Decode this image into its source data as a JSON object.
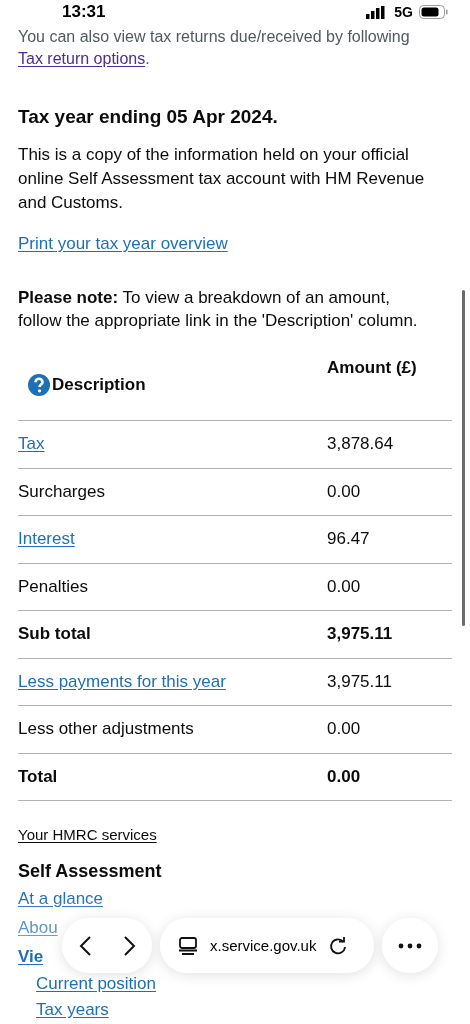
{
  "status_bar": {
    "time": "13:31",
    "network": "5G"
  },
  "intro": {
    "text": "You can also view tax returns due/received by following",
    "link": "Tax return options",
    "end": "."
  },
  "heading": "Tax year ending 05 Apr 2024.",
  "description": "This is a copy of the information held on your official online Self Assessment tax account with HM Revenue and Customs.",
  "print_link": "Print your tax year overview",
  "note": {
    "label": "Please note:",
    "text": "To view a breakdown of an amount, follow the appropriate link in the 'Description' column."
  },
  "table": {
    "columns": [
      "Description",
      "Amount (£)"
    ],
    "rows": [
      {
        "kind": "link",
        "description": "Tax",
        "amount": "3,878.64"
      },
      {
        "kind": "plain",
        "description": "Surcharges",
        "amount": "0.00"
      },
      {
        "kind": "link",
        "description": "Interest",
        "amount": "96.47"
      },
      {
        "kind": "plain",
        "description": "Penalties",
        "amount": "0.00"
      },
      {
        "kind": "bold",
        "description": "Sub total",
        "amount": "3,975.11"
      },
      {
        "kind": "link",
        "description": "Less payments for this year",
        "amount": "3,975.11"
      },
      {
        "kind": "plain",
        "description": "Less other adjustments",
        "amount": "0.00"
      },
      {
        "kind": "bold",
        "description": "Total",
        "amount": "0.00"
      }
    ]
  },
  "services": {
    "title": "Your HMRC services",
    "section": "Self Assessment",
    "links": [
      {
        "label": "At a glance",
        "bold": false
      },
      {
        "label": "Abou",
        "bold": false
      },
      {
        "label": "Vie",
        "bold": true,
        "children": [
          {
            "label": "Current position"
          },
          {
            "label": "Tax years"
          }
        ]
      }
    ]
  },
  "browser": {
    "url": "x.service.gov.uk"
  }
}
